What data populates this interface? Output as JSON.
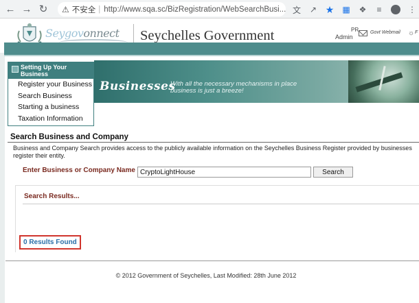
{
  "browser": {
    "security_label": "不安全",
    "url": "http://www.sqa.sc/BizRegistration/WebSearchBusi..."
  },
  "header": {
    "logo_text_prefix": "Seygov",
    "logo_text_suffix": "onnect",
    "title": "Seychelles Government",
    "pr_label": "PR",
    "admin_label": "Admin",
    "webmail_label": "Govt Webmail",
    "extra_label": "F"
  },
  "sidebar": {
    "heading": "Setting Up Your Business",
    "items": [
      {
        "label": "Register your Business"
      },
      {
        "label": "Search Business"
      },
      {
        "label": "Starting a business"
      },
      {
        "label": "Taxation Information"
      }
    ]
  },
  "banner": {
    "title": "Businesses",
    "tagline_line1": "With all the necessary mechanisms in place",
    "tagline_line2": "business is just a breeze!"
  },
  "search": {
    "section_title": "Search Business and Company",
    "description_line1": "Business and Company Search provides access to the publicly available information on the Seychelles Business Register provided by businesses",
    "description_line2": "register their entity.",
    "label": "Enter Business or Company Name",
    "input_value": "CryptoLightHouse",
    "button_label": "Search"
  },
  "results": {
    "heading": "Search Results...",
    "count_text": "0 Results Found"
  },
  "footer": {
    "text": "© 2012 Government of Seychelles, Last Modified: 28th June 2012"
  },
  "colors": {
    "teal": "#4e8c8c",
    "label_red": "#7a2a20",
    "result_blue": "#2a6fa8",
    "highlight_red": "#d0342c",
    "star_blue": "#1a73e8"
  }
}
